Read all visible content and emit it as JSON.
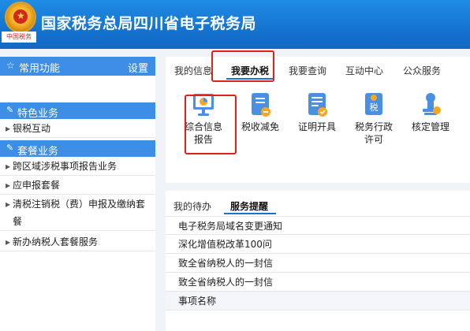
{
  "header": {
    "title": "国家税务总局四川省电子税务局",
    "seal_text": "中国税务",
    "background_color": "#1674d1"
  },
  "sidebar": {
    "common": {
      "label": "常用功能",
      "settings_label": "设置"
    },
    "featured": {
      "label": "特色业务",
      "items": [
        {
          "label": "银税互动"
        }
      ]
    },
    "packages": {
      "label": "套餐业务",
      "items": [
        {
          "label": "跨区域涉税事项报告业务"
        },
        {
          "label": "应申报套餐"
        },
        {
          "label": "清税注销税（费）申报及缴纳套餐"
        },
        {
          "label": "新办纳税人套餐服务"
        }
      ]
    }
  },
  "main": {
    "tabs": [
      {
        "label": "我的信息"
      },
      {
        "label": "我要办税"
      },
      {
        "label": "我要查询"
      },
      {
        "label": "互动中心"
      },
      {
        "label": "公众服务"
      }
    ],
    "active_tab": "我要办税",
    "services": [
      {
        "label_line1": "综合信息",
        "label_line2": "报告",
        "icon": "report-icon"
      },
      {
        "label_line1": "税收减免",
        "label_line2": "",
        "icon": "tax-relief-icon"
      },
      {
        "label_line1": "证明开具",
        "label_line2": "",
        "icon": "certificate-icon"
      },
      {
        "label_line1": "税务行政",
        "label_line2": "许可",
        "icon": "tax-permit-icon"
      },
      {
        "label_line1": "核定管理",
        "label_line2": "",
        "icon": "assessment-icon"
      }
    ],
    "permit_badge": "税"
  },
  "reminders": {
    "tabs": [
      {
        "label": "我的待办"
      },
      {
        "label": "服务提醒"
      }
    ],
    "active_tab": "服务提醒",
    "items": [
      {
        "label": "电子税务局域名变更通知"
      },
      {
        "label": "深化增值税改革100问"
      },
      {
        "label": "致全省纳税人的一封信"
      },
      {
        "label": "致全省纳税人的一封信"
      }
    ],
    "column_header": "事项名称"
  },
  "colors": {
    "accent_blue": "#3c8ee6",
    "highlight_red": "#e0211a",
    "icon_blue": "#4a90e2",
    "icon_orange": "#f5a623"
  }
}
